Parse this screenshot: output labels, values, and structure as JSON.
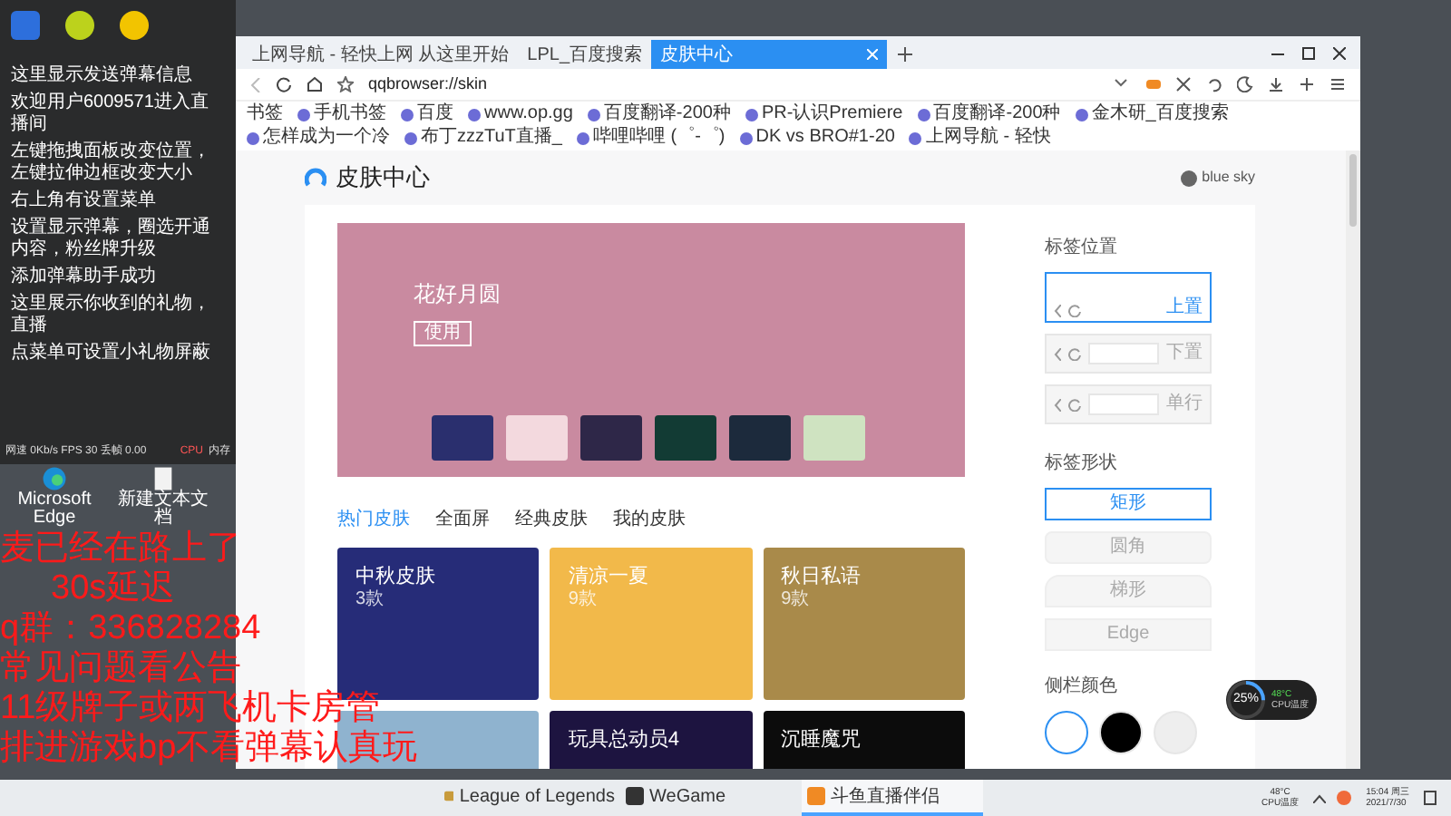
{
  "desktop_icons": [
    {
      "label": "Microsoft Edge"
    },
    {
      "label": "新建文本文档"
    }
  ],
  "chat_panel": {
    "messages": [
      "这里显示发送弹幕信息",
      "欢迎用户6009571进入直播间",
      "左键拖拽面板改变位置，左键拉伸边框改变大小",
      "右上角有设置菜单",
      "设置显示弹幕，圈选开通内容，粉丝牌升级",
      "添加弹幕助手成功",
      "这里展示你收到的礼物，直播",
      "点菜单可设置小礼物屏蔽"
    ],
    "stats": "网速 0Kb/s FPS 30 丢帧 0.00",
    "cpu_label": "CPU",
    "memory_label": "内存"
  },
  "browser": {
    "tabs": [
      {
        "label": "上网导航 - 轻快上网 从这里开始",
        "selected": false
      },
      {
        "label": "LPL_百度搜索",
        "selected": false
      },
      {
        "label": "皮肤中心",
        "selected": true
      }
    ],
    "address": "qqbrowser://skin",
    "bookmarks": [
      "书签",
      "手机书签",
      "百度",
      "www.op.gg",
      "百度翻译-200种",
      "PR-认识Premiere",
      "百度翻译-200种",
      "金木研_百度搜索",
      "怎样成为一个冷",
      "布丁zzzTuT直播_",
      "哔哩哔哩 (゜-゜)",
      "DK vs BRO#1-20",
      "上网导航 - 轻快"
    ]
  },
  "page": {
    "title": "皮肤中心",
    "user": "blue sky",
    "banner": {
      "title": "花好月圆",
      "button": "使用"
    },
    "category_tabs": [
      {
        "label": "热门皮肤",
        "selected": true
      },
      {
        "label": "全面屏",
        "selected": false
      },
      {
        "label": "经典皮肤",
        "selected": false
      },
      {
        "label": "我的皮肤",
        "selected": false
      }
    ],
    "skins": [
      {
        "kind": "titled",
        "title": "中秋皮肤",
        "count": "3款"
      },
      {
        "kind": "titled",
        "title": "清凉一夏",
        "count": "9款"
      },
      {
        "kind": "titled",
        "title": "秋日私语",
        "count": "9款"
      },
      {
        "kind": "plain"
      },
      {
        "kind": "titled",
        "title": "玩具总动员4"
      },
      {
        "kind": "titled",
        "title": "沉睡魔咒"
      }
    ],
    "tab_position": {
      "label": "标签位置",
      "options": [
        {
          "kind": "top",
          "label": "上置",
          "selected": true
        },
        {
          "kind": "bottom",
          "label": "下置",
          "selected": false
        },
        {
          "kind": "single",
          "label": "单行",
          "selected": false
        }
      ]
    },
    "tab_shape": {
      "label": "标签形状",
      "options": [
        {
          "kind": "rect",
          "label": "矩形",
          "selected": true
        },
        {
          "kind": "rounded",
          "label": "圆角",
          "selected": false
        },
        {
          "kind": "trapezoid",
          "label": "梯形",
          "selected": false
        },
        {
          "kind": "edge",
          "label": "Edge",
          "selected": false
        }
      ]
    },
    "sidebar_color": {
      "label": "侧栏颜色",
      "options": [
        {
          "color": "#ffffff",
          "selected": true
        },
        {
          "color": "#000000",
          "selected": false
        },
        {
          "color": "#eeeeee",
          "selected": false
        }
      ]
    }
  },
  "overlay_text": [
    "麦已经在路上了",
    "30s延迟",
    "q群：336828284",
    "常见问题看公告",
    "11级牌子或两飞机卡房管",
    "排进游戏bp不看弹幕认真玩"
  ],
  "cpu_widget": {
    "percent": "25%",
    "temperature": "48°C",
    "label": "CPU温度"
  },
  "taskbar": {
    "apps": [
      {
        "label": "League of Legends",
        "active": false
      },
      {
        "label": "WeGame",
        "active": false
      },
      {
        "label": "斗鱼直播伴侣",
        "active": true
      }
    ],
    "temperature": "48°C",
    "temperature_label": "CPU温度",
    "time": "15:04 周三",
    "date": "2021/7/30"
  }
}
